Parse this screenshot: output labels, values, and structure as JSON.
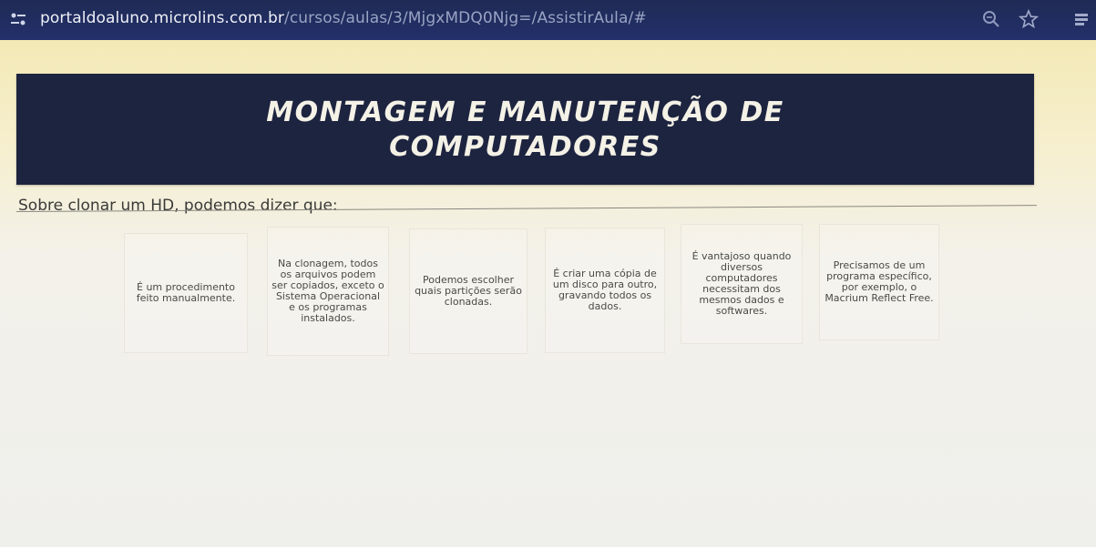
{
  "browser": {
    "url_host": "portaldoaluno.microlins.com.br",
    "url_path": "/cursos/aulas/3/MjgxMDQ0Njg=/AssistirAula/#",
    "icons": [
      "site-info-icon",
      "zoom-icon",
      "star-icon",
      "extensions-icon"
    ]
  },
  "banner": {
    "title_line1": "MONTAGEM E MANUTENÇÃO DE",
    "title_line2": "COMPUTADORES"
  },
  "question": {
    "text": "Sobre clonar um HD, podemos dizer que:"
  },
  "options": [
    {
      "text": "É um procedimento feito manualmente."
    },
    {
      "text": "Na clonagem, todos os arquivos podem ser copiados, exceto o Sistema Operacional e os programas instalados."
    },
    {
      "text": "Podemos escolher quais partições serão clonadas."
    },
    {
      "text": "É criar uma cópia de um disco para outro, gravando todos os dados."
    },
    {
      "text": "É vantajoso quando diversos computadores necessitam dos mesmos dados e softwares."
    },
    {
      "text": "Precisamos de um programa específico, por exemplo, o Macrium Reflect Free."
    }
  ],
  "colors": {
    "address_bar": "#1f2a55",
    "banner_bg": "#1d2440",
    "banner_text": "#f4f1e6",
    "page_bg": "#f6efcf"
  }
}
